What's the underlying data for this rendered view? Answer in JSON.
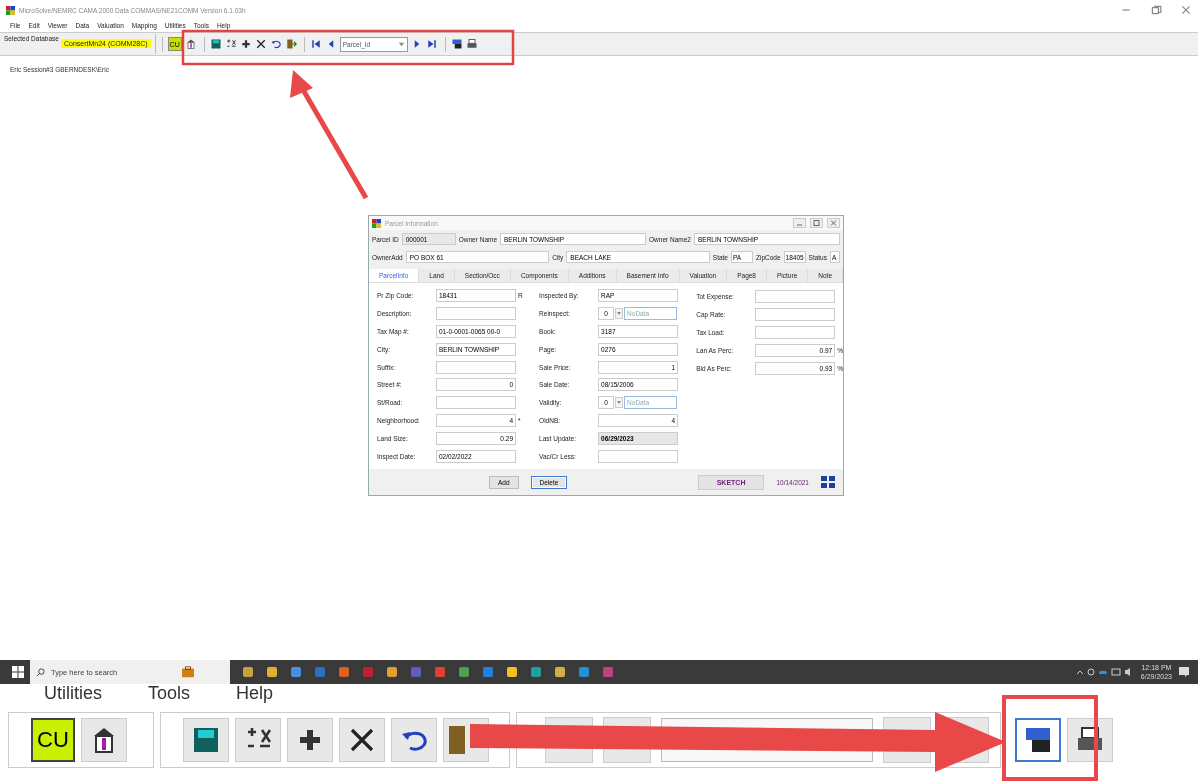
{
  "window": {
    "title": "MicroSolve/NEMRC CAMA 2000 Data COMMAS/NE21COMM Version 6.1.03h"
  },
  "menu": [
    "File",
    "Edit",
    "Viewer",
    "Data",
    "Valuation",
    "Mapping",
    "Utilities",
    "Tools",
    "Help"
  ],
  "database": {
    "label": "Selected Database",
    "value": "ConsertMn24   (COMM28C)"
  },
  "toolbar": {
    "groups": [
      [
        {
          "kind": "cu",
          "text": "CU"
        },
        {
          "kind": "bank"
        }
      ],
      [
        {
          "kind": "save"
        },
        {
          "kind": "calc"
        },
        {
          "kind": "plus"
        },
        {
          "kind": "delete"
        },
        {
          "kind": "undo"
        },
        {
          "kind": "exit"
        }
      ],
      [
        {
          "kind": "first"
        },
        {
          "kind": "prev"
        },
        {
          "kind": "combo",
          "text": "Parcel_Id"
        },
        {
          "kind": "next"
        },
        {
          "kind": "last"
        }
      ],
      [
        {
          "kind": "find"
        },
        {
          "kind": "print"
        }
      ]
    ]
  },
  "session": "Eric Session#3 GBERNDESK\\Eric",
  "dialog": {
    "title": "Parcel Information",
    "header": [
      [
        {
          "label": "Parcel ID",
          "value": "000001",
          "kind": "readonly"
        },
        {
          "label": "Owner Name",
          "value": "BERLIN TOWNSHIP",
          "kind": "text"
        },
        {
          "label": "Owner Name2",
          "value": "BERLIN TOWNSHIP",
          "kind": "text"
        }
      ],
      [
        {
          "label": "OwnerAdd",
          "value": "PO BOX 61",
          "kind": "text"
        },
        {
          "label": "City",
          "value": "BEACH LAKE",
          "kind": "text"
        },
        {
          "label": "State",
          "value": "PA",
          "kind": "small"
        },
        {
          "label": "ZipCode",
          "value": "18405",
          "kind": "small"
        },
        {
          "label": "Status",
          "value": "A",
          "kind": "tiny"
        }
      ]
    ],
    "tabs": [
      {
        "label": "ParcelInfo",
        "selected": true
      },
      {
        "label": "Land",
        "selected": false
      },
      {
        "label": "Section/Occ",
        "selected": false
      },
      {
        "label": "Components",
        "selected": false
      },
      {
        "label": "Additions",
        "selected": false
      },
      {
        "label": "Basement Info",
        "selected": false
      },
      {
        "label": "Valuation",
        "selected": false
      },
      {
        "label": "Page8",
        "selected": false
      },
      {
        "label": "Picture",
        "selected": false
      },
      {
        "label": "Note",
        "selected": false
      }
    ],
    "columns": [
      [
        {
          "label": "Pr Zip Code:",
          "value": "18431",
          "kind": "text",
          "mark": "R"
        },
        {
          "label": "Description:",
          "kind": "text"
        },
        {
          "label": "Tax Map #:",
          "value": "01-0-0001-0065 00-0",
          "kind": "text"
        },
        {
          "label": "City:",
          "value": "BERLIN TOWNSHIP",
          "kind": "text"
        },
        {
          "label": "Suffix:",
          "kind": "text"
        },
        {
          "label": "Street #:",
          "value": "0",
          "kind": "number"
        },
        {
          "label": "St/Road:",
          "kind": "text"
        },
        {
          "label": "Neighborhood:",
          "value": "4",
          "kind": "number",
          "mark": "*"
        },
        {
          "label": "Land Size:",
          "value": "0.29",
          "kind": "number"
        },
        {
          "label": "Inspect Date:",
          "value": "02/02/2022",
          "kind": "text"
        }
      ],
      [
        {
          "label": "Inspected By:",
          "value": "RAP",
          "kind": "text"
        },
        {
          "label": "Reinspect:",
          "value": "0",
          "note": "NoData",
          "kind": "combo"
        },
        {
          "label": "Book:",
          "value": "3187",
          "kind": "text"
        },
        {
          "label": "Page:",
          "value": "0276",
          "kind": "text"
        },
        {
          "label": "Sale Price:",
          "value": "1",
          "kind": "number"
        },
        {
          "label": "Sale Date:",
          "value": "08/15/2006",
          "kind": "text"
        },
        {
          "label": "Validity:",
          "value": "0",
          "note": "NoData",
          "kind": "combo"
        },
        {
          "label": "OldNB:",
          "value": "4",
          "kind": "number"
        },
        {
          "label": "Last Update:",
          "value": "06/29/2023",
          "kind": "readonly"
        },
        {
          "label": "Vac/Cr Less:",
          "kind": "text"
        }
      ],
      [
        {
          "label": "Tot Expense:",
          "kind": "text"
        },
        {
          "label": "Cap Rate:",
          "kind": "text"
        },
        {
          "label": "Tax Load:",
          "kind": "text"
        },
        {
          "label": "Lan As Perc:",
          "value": "0.97",
          "kind": "number",
          "mark": "%"
        },
        {
          "label": "Bld As Perc:",
          "value": "0.93",
          "kind": "number",
          "mark": "%"
        }
      ]
    ],
    "buttons": [
      "Add",
      "Delete"
    ],
    "sketch": "SKETCH",
    "sketch_date": "10/14/2021"
  },
  "taskbar": {
    "search_placeholder": "Type here to search",
    "time": "12:18 PM",
    "date": "6/29/2023"
  },
  "inset": {
    "menu": [
      "Utilities",
      "Tools",
      "Help"
    ],
    "cu": "CU"
  }
}
